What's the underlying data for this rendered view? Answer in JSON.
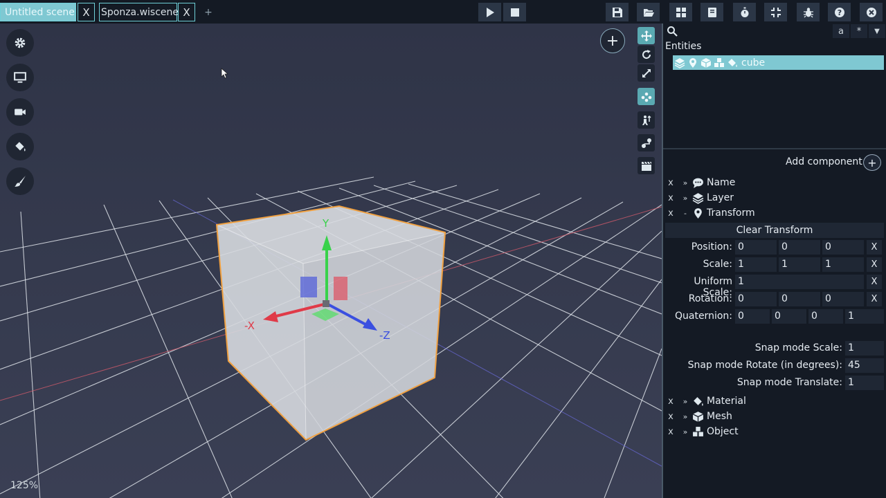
{
  "tabs": [
    {
      "label": "Untitled scene",
      "active": true
    },
    {
      "label": "Sponza.wiscene",
      "active": false
    }
  ],
  "tab_close_label": "X",
  "tab_add_label": "+",
  "toolbar": {
    "play": "play-icon",
    "stop": "stop-icon",
    "right": [
      "save-icon",
      "folder-open-icon",
      "puzzle-icon",
      "book-icon",
      "stopwatch-icon",
      "compress-icon",
      "bug-icon",
      "help-icon",
      "close-icon"
    ]
  },
  "left_tools": [
    "gear-icon",
    "monitor-icon",
    "video-camera-icon",
    "paint-bucket-icon",
    "brush-icon"
  ],
  "viewport_tools": [
    "translate-icon",
    "rotate-icon",
    "scale-icon",
    "hierarchy-icon",
    "humanoid-icon",
    "path-icon",
    "clapperboard-icon"
  ],
  "add_entity_label": "+",
  "zoom": "125%",
  "gizmo_labels": {
    "y": "Y",
    "x": "-X",
    "z": "-Z"
  },
  "colors": {
    "accent": "#7fc8d2",
    "axis_x": "#e03a48",
    "axis_y": "#38d24a",
    "axis_z": "#3a4fe0",
    "selection": "#f0a040"
  },
  "search": {
    "placeholder": "",
    "opt_a": "a",
    "opt_star": "*",
    "opt_dropdown": "▼"
  },
  "entities_label": "Entities",
  "entity": {
    "name": "cube"
  },
  "add_component_label": "Add component",
  "add_component_btn": "+",
  "components_top": [
    {
      "x": "x",
      "arrow": "»",
      "name": "Name",
      "icon": "speech-bubble-icon"
    },
    {
      "x": "x",
      "arrow": "»",
      "name": "Layer",
      "icon": "layers-icon"
    },
    {
      "x": "x",
      "arrow": "-",
      "name": "Transform",
      "icon": "map-pin-icon"
    }
  ],
  "transform": {
    "clear_label": "Clear Transform",
    "position_label": "Position:",
    "position": [
      "0",
      "0",
      "0"
    ],
    "scale_label": "Scale:",
    "scale": [
      "1",
      "1",
      "1"
    ],
    "uniform_scale_label": "Uniform Scale:",
    "uniform_scale": "1",
    "rotation_label": "Rotation:",
    "rotation": [
      "0",
      "0",
      "0"
    ],
    "quaternion_label": "Quaternion:",
    "quaternion": [
      "0",
      "0",
      "0",
      "1"
    ],
    "reset_label": "X",
    "snap_scale_label": "Snap mode Scale:",
    "snap_scale": "1",
    "snap_rotate_label": "Snap mode Rotate (in degrees):",
    "snap_rotate": "45",
    "snap_translate_label": "Snap mode Translate:",
    "snap_translate": "1"
  },
  "components_bottom": [
    {
      "x": "x",
      "arrow": "»",
      "name": "Material",
      "icon": "paint-bucket-icon"
    },
    {
      "x": "x",
      "arrow": "»",
      "name": "Mesh",
      "icon": "cube-icon"
    },
    {
      "x": "x",
      "arrow": "»",
      "name": "Object",
      "icon": "cubes-icon"
    }
  ]
}
